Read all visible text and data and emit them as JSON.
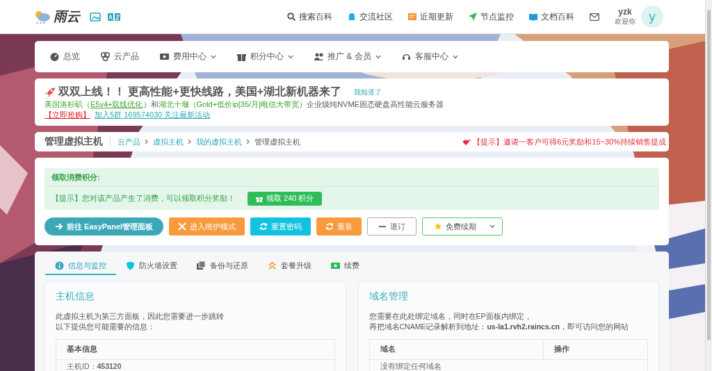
{
  "header": {
    "logo_text": "雨云",
    "links": [
      {
        "label": "搜索百科",
        "color": "#555555"
      },
      {
        "label": "交流社区",
        "color": "#1ab0e8"
      },
      {
        "label": "近期更新",
        "color": "#f5922f"
      },
      {
        "label": "节点监控",
        "color": "#2dbb55"
      },
      {
        "label": "文档百科",
        "color": "#1e9ad6"
      }
    ],
    "user": {
      "name": "yzk",
      "greeting": "欢迎你",
      "avatar_letter": "y"
    }
  },
  "nav": [
    {
      "label": "总览",
      "dropdown": false
    },
    {
      "label": "云产品",
      "dropdown": false
    },
    {
      "label": "费用中心",
      "dropdown": true
    },
    {
      "label": "积分中心",
      "dropdown": true
    },
    {
      "label": "推广 & 会员",
      "dropdown": true
    },
    {
      "label": "客服中心",
      "dropdown": true
    }
  ],
  "announcement": {
    "title": "双双上线！！ 更高性能+更快线路，美国+湖北新机器来了",
    "dismiss": "我知道了",
    "line1": [
      {
        "text": "美国洛杉矶（",
        "kind": "green"
      },
      {
        "text": "E5v4+双线优化",
        "kind": "greenlink"
      },
      {
        "text": "）",
        "kind": "green"
      },
      {
        "text": "和",
        "kind": "plain"
      },
      {
        "text": "湖北十堰（Gold+低价ip[35/月]电信大带宽）",
        "kind": "green"
      },
      {
        "text": "企业级纯NVME固态硬盘高性能云服务器",
        "kind": "plain"
      }
    ],
    "line2": [
      {
        "text": "【立即抢购】",
        "kind": "redlink"
      },
      {
        "text": "加入5群 169574030 关注最新活动",
        "kind": "link"
      }
    ]
  },
  "breadcrumb": {
    "title": "管理虚拟主机",
    "path": [
      {
        "label": "云产品",
        "link": true
      },
      {
        "label": "虚拟主机",
        "link": true
      },
      {
        "label": "我的虚拟主机",
        "link": true
      },
      {
        "label": "管理虚拟主机",
        "link": false
      }
    ],
    "tip": "【提示】邀请一客户可得6元奖励和15~30%持续销售提成"
  },
  "points": {
    "heading": "领取消费积分:",
    "message": "【提示】您对该产品产生了消费，可以领取积分奖励！",
    "button": "领取 240 积分"
  },
  "actions": [
    {
      "label": "前往 EasyPanel管理面板",
      "kind": "primary",
      "dropdown": false
    },
    {
      "label": "进入维护模式",
      "kind": "warning",
      "dropdown": false
    },
    {
      "label": "重置密码",
      "kind": "info",
      "dropdown": false
    },
    {
      "label": "重装",
      "kind": "warning",
      "dropdown": false
    },
    {
      "label": "退订",
      "kind": "outline",
      "dropdown": false
    },
    {
      "label": "免费续期",
      "kind": "success-outline",
      "dropdown": true
    }
  ],
  "tabs": [
    {
      "label": "信息与监控",
      "selected": true
    },
    {
      "label": "防火墙设置",
      "selected": false
    },
    {
      "label": "备份与还原",
      "selected": false
    },
    {
      "label": "套餐升级",
      "selected": false
    },
    {
      "label": "续费",
      "selected": false
    }
  ],
  "host_info": {
    "title": "主机信息",
    "description": [
      "此虚拟主机为第三方面板，因此您需要进一步跳转",
      "以下提供您可能需要的信息："
    ],
    "section": "基本信息",
    "field_label": "主机ID：",
    "field_value": "453120"
  },
  "domain": {
    "title": "域名管理",
    "description": [
      "您需要在此处绑定域名，同时在EP面板内绑定，",
      "再把域名CNAME记录解析到地址：**us-la1.rvh2.raincs.cn**，即可访问您的网站"
    ],
    "columns": [
      "域名",
      "操作"
    ],
    "empty": "没有绑定任何域名"
  }
}
